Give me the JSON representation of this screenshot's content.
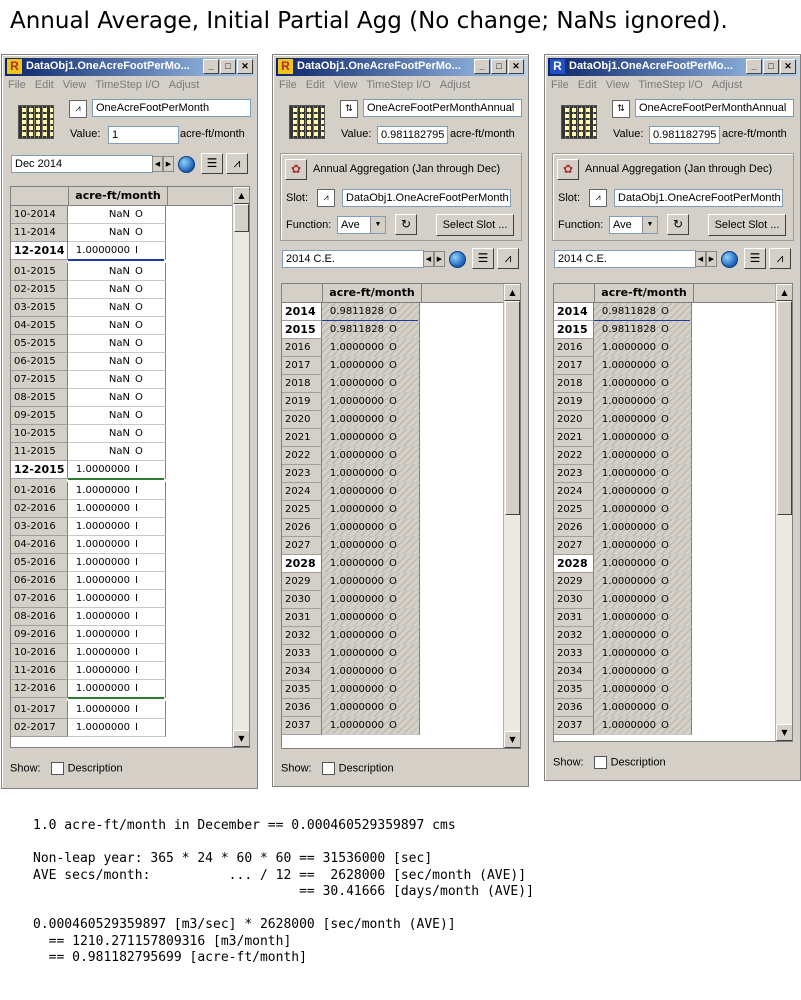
{
  "heading": "Annual Average, Initial Partial Agg (No change; NaNs ignored).",
  "menu": [
    "File",
    "Edit",
    "View",
    "TimeStep I/O",
    "Adjust"
  ],
  "footer": {
    "show_label": "Show:",
    "description_label": "Description"
  },
  "win1": {
    "title": "DataObj1.OneAcreFootPerMo...",
    "slot_name": "OneAcreFootPerMonth",
    "value_label": "Value:",
    "value": "1",
    "units": "acre-ft/month",
    "date": "Dec 2014",
    "column_header": "acre-ft/month",
    "rows": [
      {
        "label": "10-2014",
        "value": "NaN",
        "flag": "O"
      },
      {
        "label": "11-2014",
        "value": "NaN",
        "flag": "O"
      },
      {
        "label": "12-2014",
        "value": "1.0000000",
        "flag": "I",
        "bold": true,
        "line": "#1f3a9c"
      },
      {
        "label": "01-2015",
        "value": "NaN",
        "flag": "O"
      },
      {
        "label": "02-2015",
        "value": "NaN",
        "flag": "O"
      },
      {
        "label": "03-2015",
        "value": "NaN",
        "flag": "O"
      },
      {
        "label": "04-2015",
        "value": "NaN",
        "flag": "O"
      },
      {
        "label": "05-2015",
        "value": "NaN",
        "flag": "O"
      },
      {
        "label": "06-2015",
        "value": "NaN",
        "flag": "O"
      },
      {
        "label": "07-2015",
        "value": "NaN",
        "flag": "O"
      },
      {
        "label": "08-2015",
        "value": "NaN",
        "flag": "O"
      },
      {
        "label": "09-2015",
        "value": "NaN",
        "flag": "O"
      },
      {
        "label": "10-2015",
        "value": "NaN",
        "flag": "O"
      },
      {
        "label": "11-2015",
        "value": "NaN",
        "flag": "O"
      },
      {
        "label": "12-2015",
        "value": "1.0000000",
        "flag": "I",
        "bold": true,
        "line": "#2e7d32"
      },
      {
        "label": "01-2016",
        "value": "1.0000000",
        "flag": "I"
      },
      {
        "label": "02-2016",
        "value": "1.0000000",
        "flag": "I"
      },
      {
        "label": "03-2016",
        "value": "1.0000000",
        "flag": "I"
      },
      {
        "label": "04-2016",
        "value": "1.0000000",
        "flag": "I"
      },
      {
        "label": "05-2016",
        "value": "1.0000000",
        "flag": "I"
      },
      {
        "label": "06-2016",
        "value": "1.0000000",
        "flag": "I"
      },
      {
        "label": "07-2016",
        "value": "1.0000000",
        "flag": "I"
      },
      {
        "label": "08-2016",
        "value": "1.0000000",
        "flag": "I"
      },
      {
        "label": "09-2016",
        "value": "1.0000000",
        "flag": "I"
      },
      {
        "label": "10-2016",
        "value": "1.0000000",
        "flag": "I"
      },
      {
        "label": "11-2016",
        "value": "1.0000000",
        "flag": "I"
      },
      {
        "label": "12-2016",
        "value": "1.0000000",
        "flag": "I",
        "line": "#2e7d32"
      },
      {
        "label": "01-2017",
        "value": "1.0000000",
        "flag": "I"
      },
      {
        "label": "02-2017",
        "value": "1.0000000",
        "flag": "I"
      }
    ]
  },
  "win2": {
    "title": "DataObj1.OneAcreFootPerMo...",
    "slot_name": "OneAcreFootPerMonthAnnual",
    "value_label": "Value:",
    "value": "0.981182795",
    "units": "acre-ft/month",
    "agg_title": "Annual Aggregation (Jan through Dec)",
    "slot_label": "Slot:",
    "slot_value": "DataObj1.OneAcreFootPerMonth",
    "function_label": "Function:",
    "function_value": "Ave",
    "select_slot": "Select Slot ...",
    "date": "2014 C.E.",
    "column_header": "acre-ft/month",
    "rows": [
      {
        "label": "2014",
        "value": "0.9811828",
        "flag": "O",
        "bold": true,
        "line": "#1f3a9c",
        "hatch": true
      },
      {
        "label": "2015",
        "value": "0.9811828",
        "flag": "O",
        "bold": true,
        "hatch": true
      },
      {
        "label": "2016",
        "value": "1.0000000",
        "flag": "O",
        "hatch": true
      },
      {
        "label": "2017",
        "value": "1.0000000",
        "flag": "O",
        "hatch": true
      },
      {
        "label": "2018",
        "value": "1.0000000",
        "flag": "O",
        "hatch": true
      },
      {
        "label": "2019",
        "value": "1.0000000",
        "flag": "O",
        "hatch": true
      },
      {
        "label": "2020",
        "value": "1.0000000",
        "flag": "O",
        "hatch": true
      },
      {
        "label": "2021",
        "value": "1.0000000",
        "flag": "O",
        "hatch": true
      },
      {
        "label": "2022",
        "value": "1.0000000",
        "flag": "O",
        "hatch": true
      },
      {
        "label": "2023",
        "value": "1.0000000",
        "flag": "O",
        "hatch": true
      },
      {
        "label": "2024",
        "value": "1.0000000",
        "flag": "O",
        "hatch": true
      },
      {
        "label": "2025",
        "value": "1.0000000",
        "flag": "O",
        "hatch": true
      },
      {
        "label": "2026",
        "value": "1.0000000",
        "flag": "O",
        "hatch": true
      },
      {
        "label": "2027",
        "value": "1.0000000",
        "flag": "O",
        "hatch": true
      },
      {
        "label": "2028",
        "value": "1.0000000",
        "flag": "O",
        "bold": true,
        "hatch": true
      },
      {
        "label": "2029",
        "value": "1.0000000",
        "flag": "O",
        "hatch": true
      },
      {
        "label": "2030",
        "value": "1.0000000",
        "flag": "O",
        "hatch": true
      },
      {
        "label": "2031",
        "value": "1.0000000",
        "flag": "O",
        "hatch": true
      },
      {
        "label": "2032",
        "value": "1.0000000",
        "flag": "O",
        "hatch": true
      },
      {
        "label": "2033",
        "value": "1.0000000",
        "flag": "O",
        "hatch": true
      },
      {
        "label": "2034",
        "value": "1.0000000",
        "flag": "O",
        "hatch": true
      },
      {
        "label": "2035",
        "value": "1.0000000",
        "flag": "O",
        "hatch": true
      },
      {
        "label": "2036",
        "value": "1.0000000",
        "flag": "O",
        "hatch": true
      },
      {
        "label": "2037",
        "value": "1.0000000",
        "flag": "O",
        "hatch": true
      }
    ]
  },
  "win3": {
    "title": "DataObj1.OneAcreFootPerMo...",
    "slot_name": "OneAcreFootPerMonthAnnual",
    "value_label": "Value:",
    "value": "0.981182795",
    "units": "acre-ft/month",
    "agg_title": "Annual Aggregation (Jan through Dec)",
    "slot_label": "Slot:",
    "slot_value": "DataObj1.OneAcreFootPerMonth",
    "function_label": "Function:",
    "function_value": "Ave",
    "select_slot": "Select Slot ...",
    "date": "2014 C.E.",
    "column_header": "acre-ft/month",
    "rows": [
      {
        "label": "2014",
        "value": "0.9811828",
        "flag": "O",
        "bold": true,
        "line": "#1f3a9c",
        "hatch": true
      },
      {
        "label": "2015",
        "value": "0.9811828",
        "flag": "O",
        "bold": true,
        "hatch": true
      },
      {
        "label": "2016",
        "value": "1.0000000",
        "flag": "O",
        "hatch": true
      },
      {
        "label": "2017",
        "value": "1.0000000",
        "flag": "O",
        "hatch": true
      },
      {
        "label": "2018",
        "value": "1.0000000",
        "flag": "O",
        "hatch": true
      },
      {
        "label": "2019",
        "value": "1.0000000",
        "flag": "O",
        "hatch": true
      },
      {
        "label": "2020",
        "value": "1.0000000",
        "flag": "O",
        "hatch": true
      },
      {
        "label": "2021",
        "value": "1.0000000",
        "flag": "O",
        "hatch": true
      },
      {
        "label": "2022",
        "value": "1.0000000",
        "flag": "O",
        "hatch": true
      },
      {
        "label": "2023",
        "value": "1.0000000",
        "flag": "O",
        "hatch": true
      },
      {
        "label": "2024",
        "value": "1.0000000",
        "flag": "O",
        "hatch": true
      },
      {
        "label": "2025",
        "value": "1.0000000",
        "flag": "O",
        "hatch": true
      },
      {
        "label": "2026",
        "value": "1.0000000",
        "flag": "O",
        "hatch": true
      },
      {
        "label": "2027",
        "value": "1.0000000",
        "flag": "O",
        "hatch": true
      },
      {
        "label": "2028",
        "value": "1.0000000",
        "flag": "O",
        "bold": true,
        "hatch": true
      },
      {
        "label": "2029",
        "value": "1.0000000",
        "flag": "O",
        "hatch": true
      },
      {
        "label": "2030",
        "value": "1.0000000",
        "flag": "O",
        "hatch": true
      },
      {
        "label": "2031",
        "value": "1.0000000",
        "flag": "O",
        "hatch": true
      },
      {
        "label": "2032",
        "value": "1.0000000",
        "flag": "O",
        "hatch": true
      },
      {
        "label": "2033",
        "value": "1.0000000",
        "flag": "O",
        "hatch": true
      },
      {
        "label": "2034",
        "value": "1.0000000",
        "flag": "O",
        "hatch": true
      },
      {
        "label": "2035",
        "value": "1.0000000",
        "flag": "O",
        "hatch": true
      },
      {
        "label": "2036",
        "value": "1.0000000",
        "flag": "O",
        "hatch": true
      },
      {
        "label": "2037",
        "value": "1.0000000",
        "flag": "O",
        "hatch": true
      }
    ]
  },
  "notes": [
    "1.0 acre-ft/month in December == 0.000460529359897 cms",
    "",
    "Non-leap year: 365 * 24 * 60 * 60 == 31536000 [sec]",
    "AVE secs/month:          ... / 12 ==  2628000 [sec/month (AVE)]",
    "                                  == 30.41666 [days/month (AVE)]",
    "",
    "0.000460529359897 [m3/sec] * 2628000 [sec/month (AVE)]",
    "  == 1210.271157809316 [m3/month]",
    "  == 0.981182795699 [acre-ft/month]"
  ]
}
